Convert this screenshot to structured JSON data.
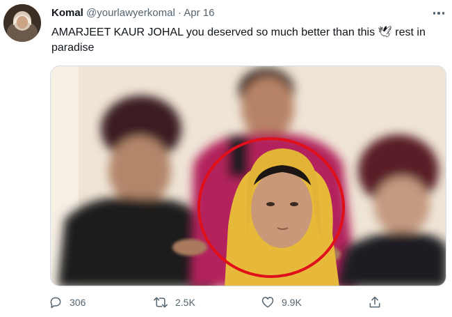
{
  "tweet": {
    "author_name": "Komal",
    "handle": "@yourlawyerkomal",
    "separator": "·",
    "date": "Apr 16",
    "text": "AMARJEET KAUR JOHAL you deserved so much better than this 🕊 rest in paradise"
  },
  "actions": {
    "replies": "306",
    "retweets": "2.5K",
    "likes": "9.9K"
  },
  "colors": {
    "text_primary": "#0f1419",
    "text_secondary": "#536471",
    "highlight_circle": "#e0101a"
  }
}
